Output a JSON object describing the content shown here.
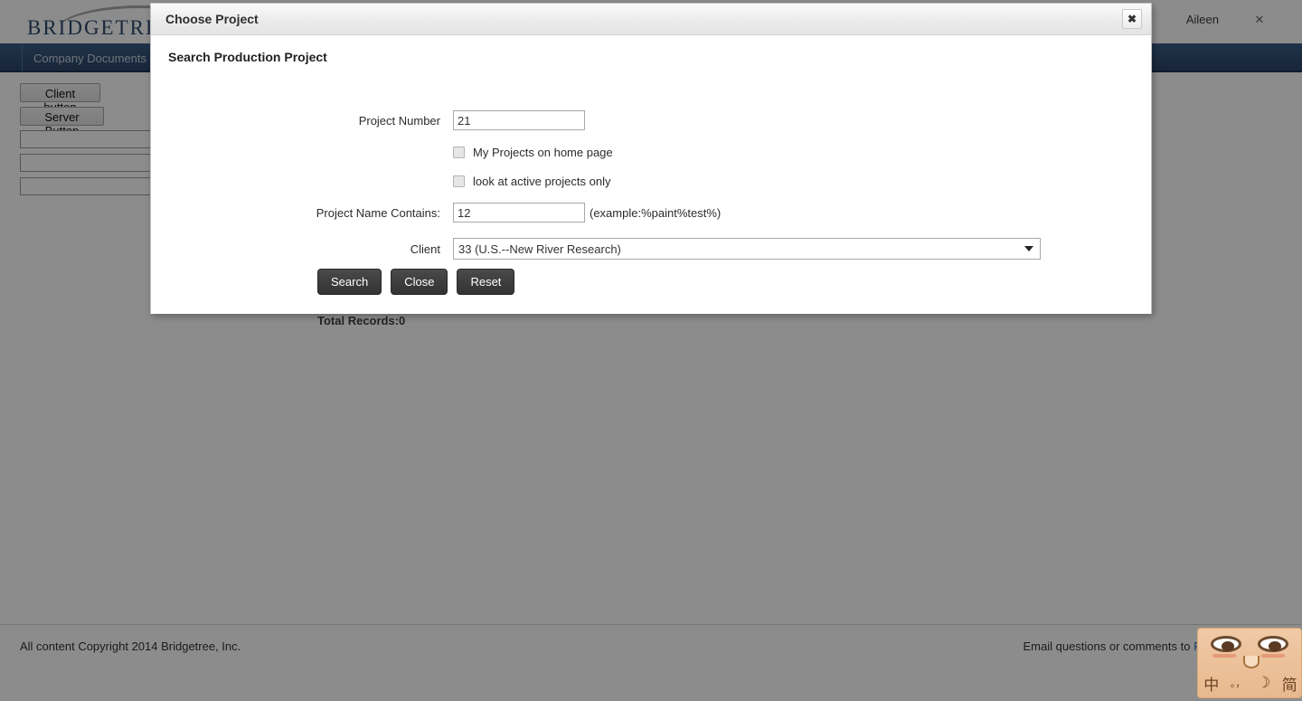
{
  "background": {
    "logo_text": "BRIDGETREE",
    "user_name": "Aileen",
    "close_icon": "✕",
    "nav_item": "Company Documents",
    "buttons": {
      "client": "Client button",
      "server": "Server Button"
    },
    "inputs": {
      "field1": "",
      "field2": "",
      "field3": ""
    },
    "footer": {
      "copyright": "All content Copyright 2014 Bridgetree, Inc.",
      "email_prefix": "Email questions or comments to ",
      "email_link": "PCS@"
    }
  },
  "dialog": {
    "title": "Choose Project",
    "close_icon": "✖",
    "panel_heading": "Search Production Project",
    "fields": {
      "project_number_label": "Project Number",
      "project_number_value": "21",
      "checkbox_home_label": "My Projects on home page",
      "checkbox_home_checked": "false",
      "checkbox_active_label": "look at active projects only",
      "checkbox_active_checked": "false",
      "project_name_label": "Project Name Contains:",
      "project_name_value": "12",
      "project_name_hint": "(example:%paint%test%)",
      "client_label": "Client",
      "client_value": "33 (U.S.--New River Research)"
    },
    "buttons": {
      "search": "Search",
      "close": "Close",
      "reset": "Reset"
    },
    "total_records": "Total Records:0"
  },
  "ime": {
    "lang_key": "中",
    "punct_key": "。，",
    "moon_key": "☽",
    "simple_key": "简"
  },
  "colors": {
    "nav_blue": "#2b4569",
    "logo_navy": "#2e4a6e",
    "overlay": "rgba(0,0,0,0.45)",
    "button_dark": "#333333",
    "link_blue": "#3b6fa8"
  }
}
